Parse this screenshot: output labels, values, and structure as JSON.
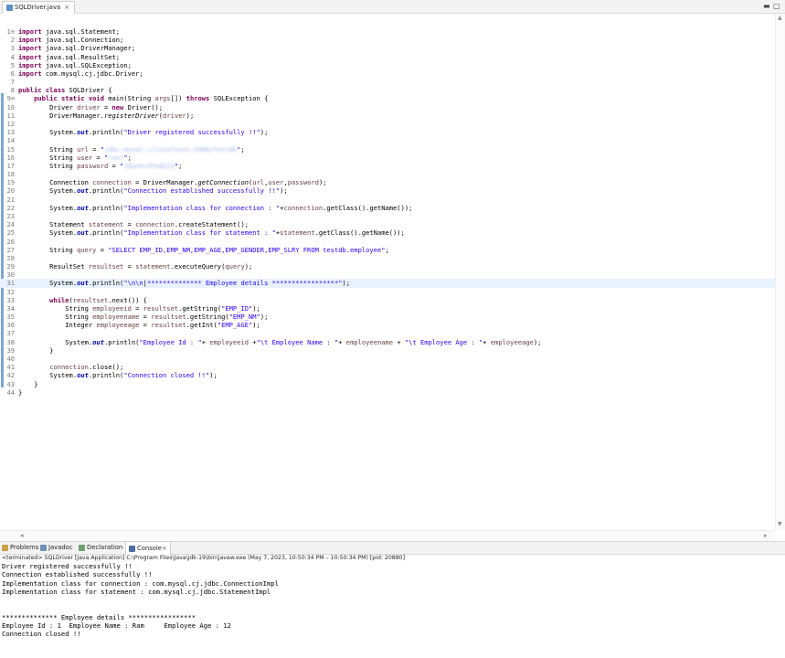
{
  "editor": {
    "tab_label": "SQLDriver.java",
    "tab_close": "×",
    "minimize_glyph": "▬",
    "maximize_glyph": "▢"
  },
  "code_lines": [
    {
      "num": "1",
      "html": "<span class=\"kw\">import</span> java.sql.Statement;",
      "mark": "⊖"
    },
    {
      "num": "2",
      "html": "<span class=\"kw\">import</span> java.sql.Connection;"
    },
    {
      "num": "3",
      "html": "<span class=\"kw\">import</span> java.sql.DriverManager;"
    },
    {
      "num": "4",
      "html": "<span class=\"kw\">import</span> java.sql.ResultSet;"
    },
    {
      "num": "5",
      "html": "<span class=\"kw\">import</span> java.sql.SQLException;"
    },
    {
      "num": "6",
      "html": "<span class=\"kw\">import</span> com.mysql.cj.jdbc.Driver;"
    },
    {
      "num": "7",
      "html": ""
    },
    {
      "num": "8",
      "html": "<span class=\"kw\">public class</span> SQLDriver {"
    },
    {
      "num": "9",
      "html": "    <span class=\"kw\">public static void</span> main(String <span class=\"var\">args</span>[]) <span class=\"kw\">throws</span> SQLException {",
      "mark": "⊖"
    },
    {
      "num": "10",
      "html": "        Driver <span class=\"var\">driver</span> = <span class=\"kw\">new</span> Driver();"
    },
    {
      "num": "11",
      "html": "        DriverManager.<span class=\"it\">registerDriver</span>(<span class=\"var\">driver</span>);"
    },
    {
      "num": "12",
      "html": ""
    },
    {
      "num": "13",
      "html": "        System.<span class=\"fld it\">out</span>.println(<span class=\"str\">\"Driver registered successfully !!\"</span>);"
    },
    {
      "num": "14",
      "html": ""
    },
    {
      "num": "15",
      "html": "        String <span class=\"var\">url</span> = <span class=\"str\">\"</span><span class=\"blur\">jdbc:mysql://localhost:3306/testdb</span><span class=\"str\">\"</span>;"
    },
    {
      "num": "16",
      "html": "        String <span class=\"var\">user</span> = <span class=\"str\">\"</span><span class=\"blur\">root</span><span class=\"str\">\"</span>;"
    },
    {
      "num": "17",
      "html": "        String <span class=\"var\">password</span> = <span class=\"str\">\"</span><span class=\"blur\">Jdunbcdfe@123</span><span class=\"str\">\"</span>;"
    },
    {
      "num": "18",
      "html": ""
    },
    {
      "num": "19",
      "html": "        Connection <span class=\"var\">connection</span> = DriverManager.<span class=\"it\">getConnection</span>(<span class=\"var\">url</span>,<span class=\"var\">user</span>,<span class=\"var\">password</span>);"
    },
    {
      "num": "20",
      "html": "        System.<span class=\"fld it\">out</span>.println(<span class=\"str\">\"Connection established successfully !!\"</span>);"
    },
    {
      "num": "21",
      "html": ""
    },
    {
      "num": "22",
      "html": "        System.<span class=\"fld it\">out</span>.println(<span class=\"str\">\"Implementation class for connection : \"</span>+<span class=\"var\">connection</span>.getClass().getName());"
    },
    {
      "num": "23",
      "html": ""
    },
    {
      "num": "24",
      "html": "        Statement <span class=\"var\">statement</span> = <span class=\"var\">connection</span>.createStatement();"
    },
    {
      "num": "25",
      "html": "        System.<span class=\"fld it\">out</span>.println(<span class=\"str\">\"Implementation class for statement : \"</span>+<span class=\"var\">statement</span>.getClass().getName());"
    },
    {
      "num": "26",
      "html": ""
    },
    {
      "num": "27",
      "html": "        String <span class=\"var\">query</span> = <span class=\"str\">\"SELECT EMP_ID,EMP_NM,EMP_AGE,EMP_GENDER,EMP_SLRY FROM testdb.employee\"</span>;"
    },
    {
      "num": "28",
      "html": ""
    },
    {
      "num": "29",
      "html": "        ResultSet <span class=\"var\">resultset</span> = <span class=\"var\">statement</span>.executeQuery(<span class=\"var\">query</span>);"
    },
    {
      "num": "30",
      "html": ""
    },
    {
      "num": "31",
      "html": "        System.<span class=\"fld it\">out</span>.println(<span class=\"str\">\"\\n\\n</span>|<span class=\"str\">************** Employee details *****************\"</span>);",
      "cur": true
    },
    {
      "num": "32",
      "html": ""
    },
    {
      "num": "33",
      "html": "        <span class=\"kw\">while</span>(<span class=\"var\">resultset</span>.next()) {"
    },
    {
      "num": "34",
      "html": "            String <span class=\"var\">employeeid</span> = <span class=\"var\">resultset</span>.getString(<span class=\"str\">\"EMP_ID\"</span>);"
    },
    {
      "num": "35",
      "html": "            String <span class=\"var\">employeename</span> = <span class=\"var\">resultset</span>.getString(<span class=\"str\">\"EMP_NM\"</span>);"
    },
    {
      "num": "36",
      "html": "            Integer <span class=\"var\">employeeage</span> = <span class=\"var\">resultset</span>.getInt(<span class=\"str\">\"EMP_AGE\"</span>);"
    },
    {
      "num": "37",
      "html": ""
    },
    {
      "num": "38",
      "html": "            System.<span class=\"fld it\">out</span>.println(<span class=\"str\">\"Employee Id : \"</span>+ <span class=\"var\">employeeid</span> +<span class=\"str\">\"\\t Employee Name : \"</span>+ <span class=\"var\">employeename</span> + <span class=\"str\">\"\\t Employee Age : \"</span>+ <span class=\"var\">employeeage</span>);"
    },
    {
      "num": "39",
      "html": "        }"
    },
    {
      "num": "40",
      "html": ""
    },
    {
      "num": "41",
      "html": "        <span class=\"var\">connection</span>.close();"
    },
    {
      "num": "42",
      "html": "        System.<span class=\"fld it\">out</span>.println(<span class=\"str\">\"Connection closed !!\"</span>);"
    },
    {
      "num": "43",
      "html": "    }"
    },
    {
      "num": "44",
      "html": "}"
    }
  ],
  "panel": {
    "tabs": [
      {
        "label": "Problems",
        "icon": "problems-icon",
        "color": "#c9a24a"
      },
      {
        "label": "Javadoc",
        "icon": "javadoc-icon",
        "color": "#6f8fb8"
      },
      {
        "label": "Declaration",
        "icon": "declaration-icon",
        "color": "#6fa06f"
      },
      {
        "label": "Console",
        "icon": "console-icon",
        "color": "#4a6fa5",
        "active": true,
        "close": "×"
      }
    ],
    "terminated": "<terminated> SQLDriver [Java Application] C:\\Program Files\\Java\\jdk-19\\bin\\javaw.exe  (May 7, 2023, 10:50:34 PM – 10:50:34 PM) [pid: 20880]",
    "console_lines": [
      "Driver registered successfully !!",
      "Connection established successfully !!",
      "Implementation class for connection : com.mysql.cj.jdbc.ConnectionImpl",
      "Implementation class for statement : com.mysql.cj.jdbc.StatementImpl",
      "",
      "",
      "************** Employee details *****************",
      "Employee Id : 1  Employee Name : Ram     Employee Age : 12",
      "Connection closed !!"
    ]
  }
}
